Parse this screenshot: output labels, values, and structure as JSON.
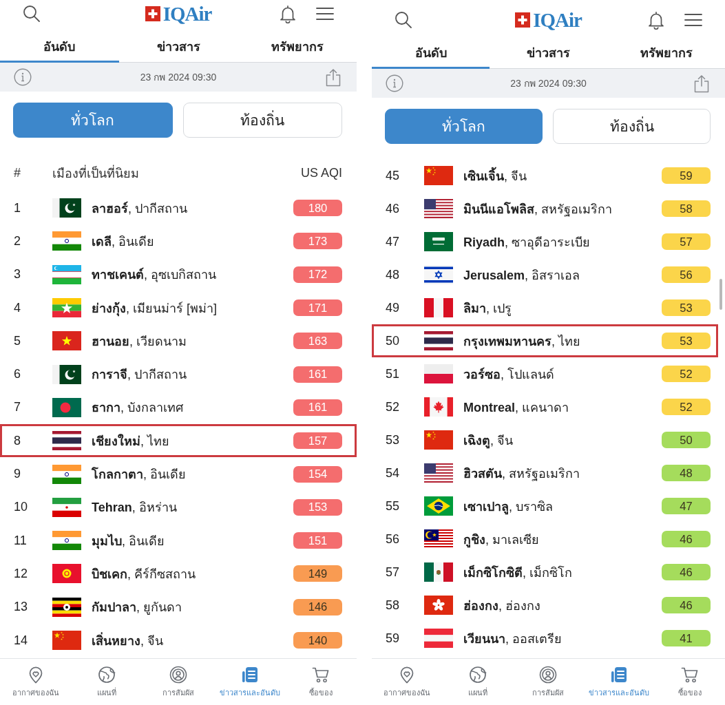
{
  "panels": [
    {
      "header": {
        "logo": "IQAir"
      },
      "tabs": [
        {
          "label": "อันดับ",
          "selected": true
        },
        {
          "label": "ข่าวสาร",
          "selected": false
        },
        {
          "label": "ทรัพยากร",
          "selected": false
        }
      ],
      "updated": "23 กพ 2024 09:30",
      "scope": [
        {
          "label": "ทั่วโลก",
          "selected": true
        },
        {
          "label": "ท้องถิ่น",
          "selected": false
        }
      ],
      "table_header": {
        "rank": "#",
        "city": "เมืองที่เป็นที่นิยม",
        "aqi": "US AQI"
      },
      "rows": [
        {
          "rank": "1",
          "kind": "pakistan",
          "city": "**ลาฮอร์**, ปากีสถาน",
          "aqi": "180",
          "color": "#f46d6e",
          "highlighted": false
        },
        {
          "rank": "2",
          "kind": "india",
          "city": "**เดลี**, อินเดีย",
          "aqi": "173",
          "color": "#f46d6e",
          "highlighted": false
        },
        {
          "rank": "3",
          "kind": "uzbekistan",
          "city": "**ทาชเคนต์**, อุซเบกิสถาน",
          "aqi": "172",
          "color": "#f46d6e",
          "highlighted": false
        },
        {
          "rank": "4",
          "kind": "myanmar",
          "city": "**ย่างกุ้ง**, เมียนม่าร์ [พม่า]",
          "aqi": "171",
          "color": "#f46d6e",
          "highlighted": false
        },
        {
          "rank": "5",
          "kind": "vietnam",
          "city": "**ฮานอย**, เวียดนาม",
          "aqi": "163",
          "color": "#f46d6e",
          "highlighted": false
        },
        {
          "rank": "6",
          "kind": "pakistan",
          "city": "**การาจี**, ปากีสถาน",
          "aqi": "161",
          "color": "#f46d6e",
          "highlighted": false
        },
        {
          "rank": "7",
          "kind": "bangladesh",
          "city": "**ธากา**, บังกลาเทศ",
          "aqi": "161",
          "color": "#f46d6e",
          "highlighted": false
        },
        {
          "rank": "8",
          "kind": "thailand",
          "city": "**เชียงใหม่**, ไทย",
          "aqi": "157",
          "color": "#f46d6e",
          "highlighted": true
        },
        {
          "rank": "9",
          "kind": "india",
          "city": "**โกลกาตา**, อินเดีย",
          "aqi": "154",
          "color": "#f46d6e",
          "highlighted": false
        },
        {
          "rank": "10",
          "kind": "iran",
          "city": "**Tehran**, อิหร่าน",
          "aqi": "153",
          "color": "#f46d6e",
          "highlighted": false
        },
        {
          "rank": "11",
          "kind": "india",
          "city": "**มุมไบ**, อินเดีย",
          "aqi": "151",
          "color": "#f46d6e",
          "highlighted": false
        },
        {
          "rank": "12",
          "kind": "kyrgyzstan",
          "city": "**บิชเคก**, คีร์กีซสถาน",
          "aqi": "149",
          "color": "#f99b52",
          "highlighted": false
        },
        {
          "rank": "13",
          "kind": "uganda",
          "city": "**กัมปาลา**, ยูกันดา",
          "aqi": "146",
          "color": "#f99b52",
          "highlighted": false
        },
        {
          "rank": "14",
          "kind": "china",
          "city": "**เสิ่นหยาง**, จีน",
          "aqi": "140",
          "color": "#f99b52",
          "highlighted": false
        }
      ],
      "bottom_nav": [
        {
          "kind": "heart-pin",
          "label": "อากาศของฉัน",
          "selected": false
        },
        {
          "kind": "globe",
          "label": "แผนที่",
          "selected": false
        },
        {
          "kind": "exposure",
          "label": "การสัมผัส",
          "selected": false
        },
        {
          "kind": "news",
          "label": "ข่าวสารและอันดับ",
          "selected": true
        },
        {
          "kind": "cart",
          "label": "ซื้อของ",
          "selected": false
        }
      ]
    },
    {
      "header": {
        "logo": "IQAir"
      },
      "tabs": [
        {
          "label": "อันดับ",
          "selected": true
        },
        {
          "label": "ข่าวสาร",
          "selected": false
        },
        {
          "label": "ทรัพยากร",
          "selected": false
        }
      ],
      "updated": "23 กพ 2024 09:30",
      "scope": [
        {
          "label": "ทั่วโลก",
          "selected": true
        },
        {
          "label": "ท้องถิ่น",
          "selected": false
        }
      ],
      "rows": [
        {
          "rank": "45",
          "kind": "china",
          "city": "**เซินเจิ้น**, จีน",
          "aqi": "59",
          "color": "#fbd54a",
          "highlighted": false
        },
        {
          "rank": "46",
          "kind": "usa",
          "city": "**มินนีแอโพลิส**, สหรัฐอเมริกา",
          "aqi": "58",
          "color": "#fbd54a",
          "highlighted": false
        },
        {
          "rank": "47",
          "kind": "saudi",
          "city": "**Riyadh**, ซาอุดีอาระเบีย",
          "aqi": "57",
          "color": "#fbd54a",
          "highlighted": false
        },
        {
          "rank": "48",
          "kind": "israel",
          "city": "**Jerusalem**, อิสราเอล",
          "aqi": "56",
          "color": "#fbd54a",
          "highlighted": false
        },
        {
          "rank": "49",
          "kind": "peru",
          "city": "**ลิมา**, เปรู",
          "aqi": "53",
          "color": "#fbd54a",
          "highlighted": false
        },
        {
          "rank": "50",
          "kind": "thailand",
          "city": "**กรุงเทพมหานคร**, ไทย",
          "aqi": "53",
          "color": "#fbd54a",
          "highlighted": true
        },
        {
          "rank": "51",
          "kind": "poland",
          "city": "**วอร์ซอ**, โปแลนด์",
          "aqi": "52",
          "color": "#fbd54a",
          "highlighted": false
        },
        {
          "rank": "52",
          "kind": "canada",
          "city": "**Montreal**, แคนาดา",
          "aqi": "52",
          "color": "#fbd54a",
          "highlighted": false
        },
        {
          "rank": "53",
          "kind": "china",
          "city": "**เฉิงตู**, จีน",
          "aqi": "50",
          "color": "#a5dc5c",
          "highlighted": false
        },
        {
          "rank": "54",
          "kind": "usa",
          "city": "**ฮิวสตัน**, สหรัฐอเมริกา",
          "aqi": "48",
          "color": "#a5dc5c",
          "highlighted": false
        },
        {
          "rank": "55",
          "kind": "brazil",
          "city": "**เซาเปาลู**, บราซิล",
          "aqi": "47",
          "color": "#a5dc5c",
          "highlighted": false
        },
        {
          "rank": "56",
          "kind": "malaysia",
          "city": "**กูชิง**, มาเลเซีย",
          "aqi": "46",
          "color": "#a5dc5c",
          "highlighted": false
        },
        {
          "rank": "57",
          "kind": "mexico",
          "city": "**เม็กซิโกซิตี**, เม็กซิโก",
          "aqi": "46",
          "color": "#a5dc5c",
          "highlighted": false
        },
        {
          "rank": "58",
          "kind": "hongkong",
          "city": "**ฮ่องกง**, ฮ่องกง",
          "aqi": "46",
          "color": "#a5dc5c",
          "highlighted": false
        },
        {
          "rank": "59",
          "kind": "austria",
          "city": "**เวียนนา**, ออสเตรีย",
          "aqi": "41",
          "color": "#a5dc5c",
          "highlighted": false
        }
      ],
      "bottom_nav": [
        {
          "kind": "heart-pin",
          "label": "อากาศของฉัน",
          "selected": false
        },
        {
          "kind": "globe",
          "label": "แผนที่",
          "selected": false
        },
        {
          "kind": "exposure",
          "label": "การสัมผัส",
          "selected": false
        },
        {
          "kind": "news",
          "label": "ข่าวสารและอันดับ",
          "selected": true
        },
        {
          "kind": "cart",
          "label": "ซื้อของ",
          "selected": false
        }
      ]
    }
  ]
}
